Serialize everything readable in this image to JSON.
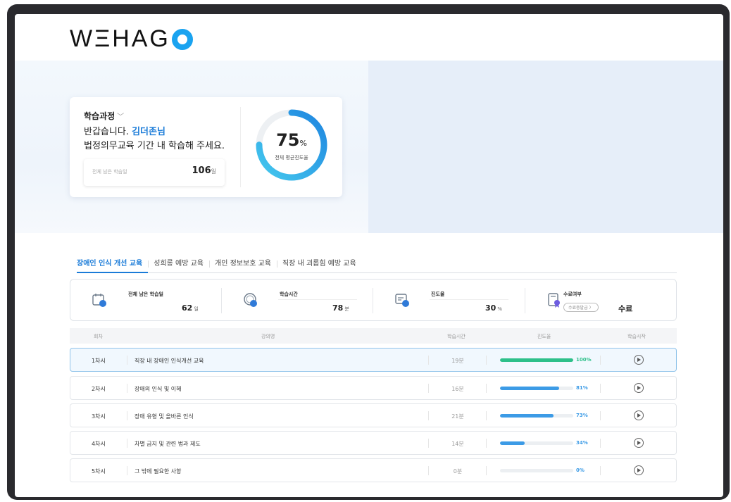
{
  "brand": {
    "logo_text": "WΞHAG"
  },
  "summary": {
    "course_label": "학습과정",
    "greeting_prefix": "반갑습니다. ",
    "user_name": "김더존님",
    "instruction": "법정의무교육 기간 내 학습해 주세요.",
    "remaining_label": "전체 남은 학습일",
    "remaining_value": "106",
    "remaining_unit": "일",
    "progress_value": "75",
    "progress_unit": "%",
    "progress_fraction": 0.75,
    "progress_caption": "전체 평균진도율"
  },
  "tabs": [
    {
      "label": "장애인 인식 개선 교육",
      "active": true
    },
    {
      "label": "성희롱 예방 교육",
      "active": false
    },
    {
      "label": "개인 정보보호 교육",
      "active": false
    },
    {
      "label": "직장 내 괴롭힘 예방 교육",
      "active": false
    }
  ],
  "stats": {
    "remaining": {
      "label": "전체 남은 학습일",
      "value": "62",
      "unit": "일"
    },
    "time": {
      "label": "학습시간",
      "value": "78",
      "unit": "분"
    },
    "progress": {
      "label": "진도율",
      "value": "30",
      "unit": "%"
    },
    "completion": {
      "label": "수료여부",
      "button": "수료증발급 〉",
      "value": "수료"
    }
  },
  "table": {
    "headers": {
      "round": "회차",
      "title": "강의명",
      "time": "학습시간",
      "progress": "진도율",
      "start": "학습시작"
    },
    "rows": [
      {
        "round": "1차시",
        "title": "직장 내 장애인 인식개선 교육",
        "time": "19분",
        "progress": "100%",
        "fraction": 1.0,
        "color": "#2dc08a",
        "selected": true
      },
      {
        "round": "2차시",
        "title": "장애의 인식 및 이해",
        "time": "16분",
        "progress": "81%",
        "fraction": 0.81,
        "color": "#3c9be6",
        "selected": false
      },
      {
        "round": "3차시",
        "title": "장애 유형 및 올바른 인식",
        "time": "21분",
        "progress": "73%",
        "fraction": 0.73,
        "color": "#3c9be6",
        "selected": false
      },
      {
        "round": "4차시",
        "title": "차별 금지 및 관련 법과 제도",
        "time": "14분",
        "progress": "34%",
        "fraction": 0.34,
        "color": "#3c9be6",
        "selected": false
      },
      {
        "round": "5차시",
        "title": "그 밖에 필요한 사항",
        "time": "0분",
        "progress": "0%",
        "fraction": 0.0,
        "color": "#3c9be6",
        "selected": false
      }
    ]
  },
  "colors": {
    "accent": "#1a7bd8",
    "complete": "#2dc08a",
    "progress": "#3c9be6",
    "pct_text_done": "#2dc08a",
    "pct_text": "#3c9be6"
  }
}
